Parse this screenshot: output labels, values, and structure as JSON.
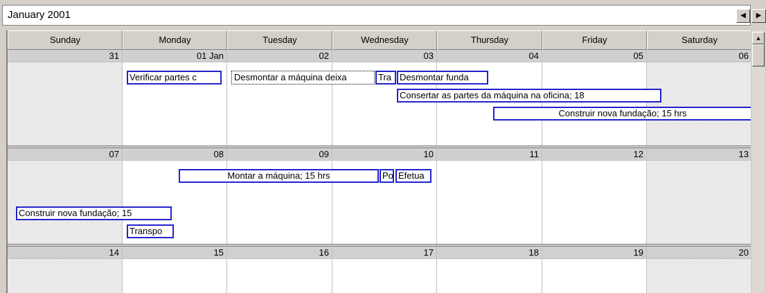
{
  "header": {
    "title": "January 2001"
  },
  "nav": {
    "prev_glyph": "◀",
    "next_glyph": "▶"
  },
  "scrollbar": {
    "up_glyph": "▲"
  },
  "days": [
    "Sunday",
    "Monday",
    "Tuesday",
    "Wednesday",
    "Thursday",
    "Friday",
    "Saturday"
  ],
  "weeks": [
    {
      "dates": [
        "31",
        "01 Jan",
        "02",
        "03",
        "04",
        "05",
        "06"
      ]
    },
    {
      "dates": [
        "07",
        "08",
        "09",
        "10",
        "11",
        "12",
        "13"
      ]
    },
    {
      "dates": [
        "14",
        "15",
        "16",
        "17",
        "18",
        "19",
        "20"
      ]
    }
  ],
  "events": [
    {
      "text": "Verificar partes c"
    },
    {
      "text": "Desmontar a máquina deixa"
    },
    {
      "text": "Tra"
    },
    {
      "text": "Desmontar funda"
    },
    {
      "text": "Consertar as partes da máquina na oficina; 18"
    },
    {
      "text": "Construir nova fundação; 15 hrs"
    },
    {
      "text": "Montar a máquina; 15 hrs"
    },
    {
      "text": "Po"
    },
    {
      "text": "Efetua"
    },
    {
      "text": "Construir nova fundação; 15"
    },
    {
      "text": "Transpo"
    }
  ],
  "colors": {
    "event_border": "#2222cc",
    "chrome": "#d4d0c8"
  }
}
